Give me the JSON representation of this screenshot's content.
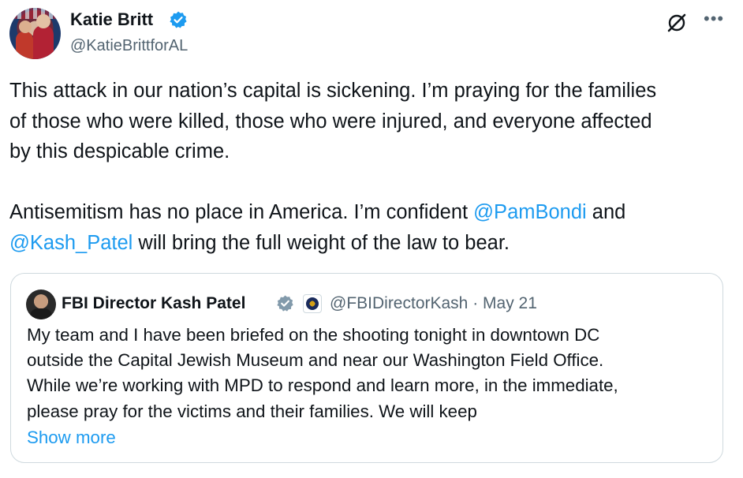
{
  "author": {
    "name": "Katie Britt",
    "handle": "@KatieBrittforAL"
  },
  "tweet": {
    "line1": "This attack in our nation’s capital is sickening. I’m praying for the families\nof those who were killed, those who were injured, and everyone affected\nby this despicable crime.\n\nAntisemitism has no place in America. I’m confident ",
    "mention1": "@PamBondi",
    "mid": " and\n",
    "mention2": "@Kash_Patel",
    "end": " will bring the full weight of the law to bear."
  },
  "quote": {
    "name": "FBI Director Kash Patel",
    "handle_date": "@FBIDirectorKash · May 21",
    "text": "My team and I have been briefed on the shooting tonight in downtown DC\noutside the Capital Jewish Museum and near our Washington Field Office.\nWhile we’re working with MPD to respond and learn more, in the immediate,\nplease pray for the victims and their families. We will keep",
    "show_more": "Show more"
  },
  "icons": {
    "verified_color": "#1d9bf0",
    "verified_gov_color": "#829aab",
    "grok": "grok-icon",
    "more": "more-icon"
  }
}
